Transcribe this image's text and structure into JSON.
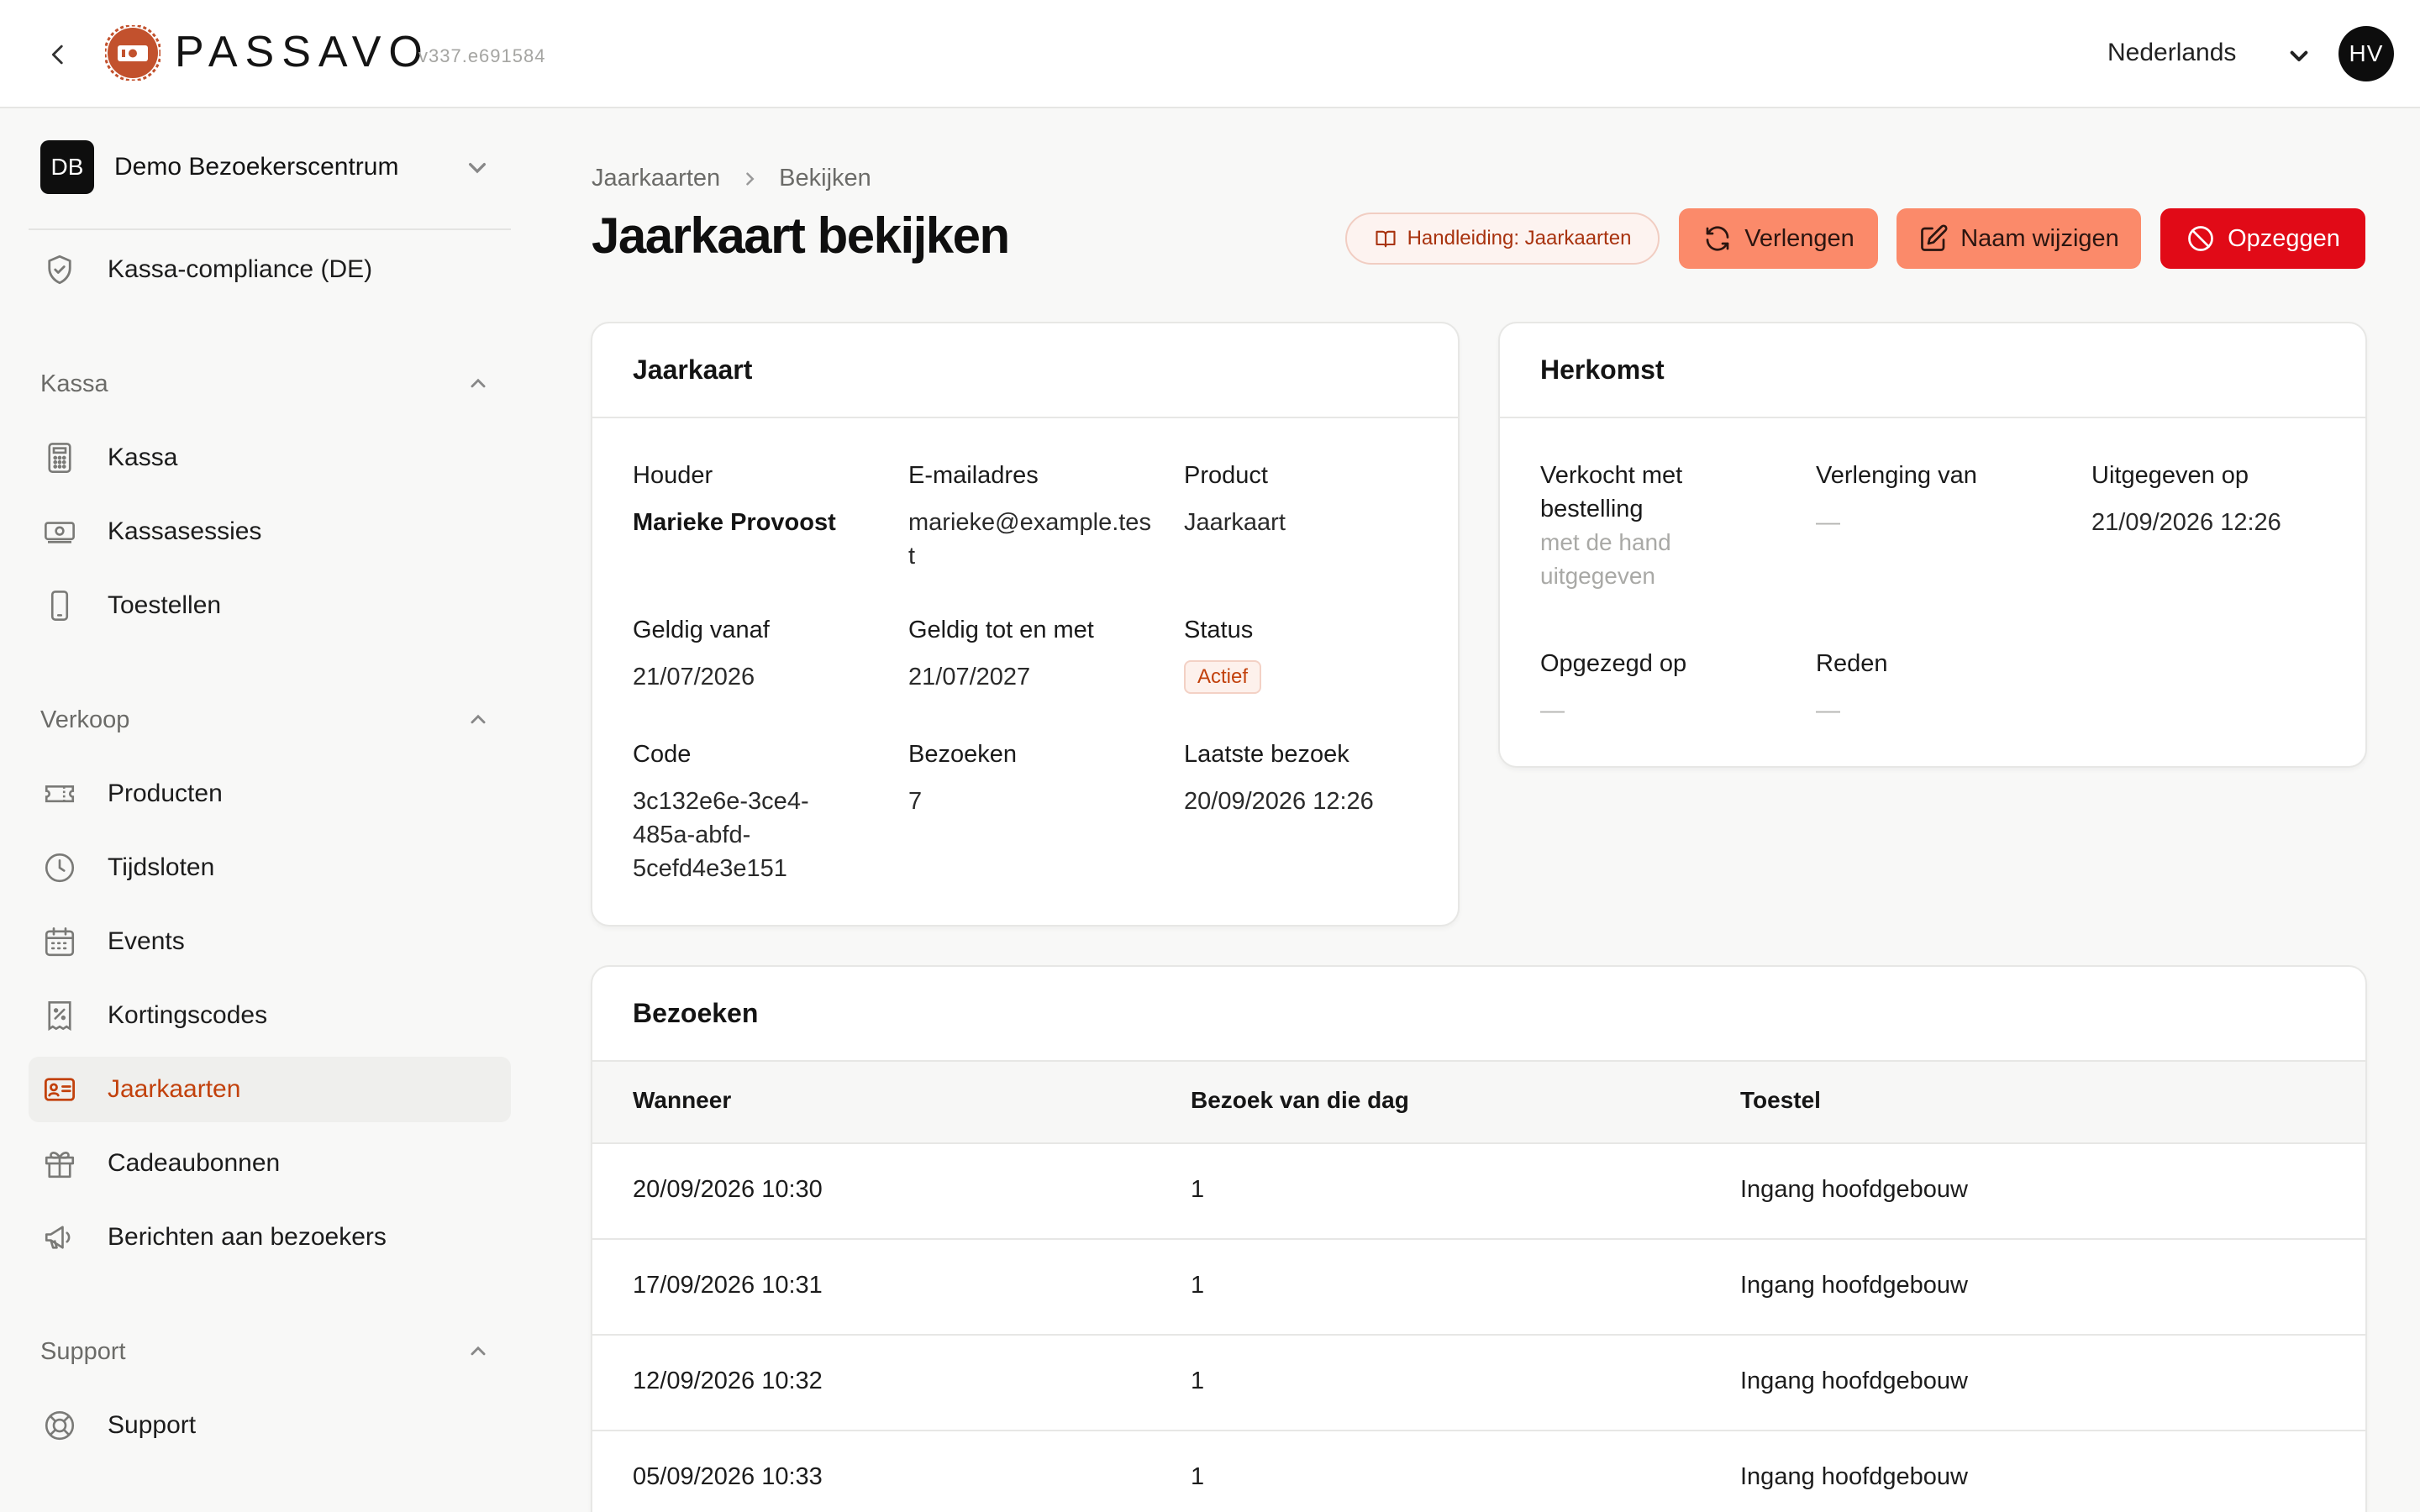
{
  "header": {
    "brand": "PASSAVO",
    "version": "v337.e691584",
    "language": "Nederlands",
    "avatar_initials": "HV"
  },
  "sidebar": {
    "org_initials": "DB",
    "org_name": "Demo Bezoekerscentrum",
    "compliance": "Kassa-compliance (DE)",
    "sections": [
      {
        "label": "Kassa",
        "items": [
          "Kassa",
          "Kassasessies",
          "Toestellen"
        ]
      },
      {
        "label": "Verkoop",
        "items": [
          "Producten",
          "Tijdsloten",
          "Events",
          "Kortingscodes",
          "Jaarkaarten",
          "Cadeaubonnen",
          "Berichten aan bezoekers"
        ]
      },
      {
        "label": "Support",
        "items": [
          "Support"
        ]
      }
    ],
    "active_item": "Jaarkaarten"
  },
  "breadcrumb": [
    "Jaarkaarten",
    "Bekijken"
  ],
  "page_title": "Jaarkaart bekijken",
  "actions": {
    "guide": "Handleiding: Jaarkaarten",
    "renew": "Verlengen",
    "rename": "Naam wijzigen",
    "cancel": "Opzeggen"
  },
  "colors": {
    "accent": "#fb8a6a",
    "danger": "#e10a17",
    "active_text": "#c2410c"
  },
  "card_pass": {
    "title": "Jaarkaart",
    "holder_label": "Houder",
    "holder": "Marieke Provoost",
    "email_label": "E-mailadres",
    "email": "marieke@example.test",
    "product_label": "Product",
    "product": "Jaarkaart",
    "valid_from_label": "Geldig vanaf",
    "valid_from": "21/07/2026",
    "valid_until_label": "Geldig tot en met",
    "valid_until": "21/07/2027",
    "status_label": "Status",
    "status": "Actief",
    "code_label": "Code",
    "code": "3c132e6e-3ce4-485a-abfd-5cefd4e3e151",
    "visits_label": "Bezoeken",
    "visits": "7",
    "last_visit_label": "Laatste bezoek",
    "last_visit": "20/09/2026 12:26"
  },
  "card_origin": {
    "title": "Herkomst",
    "sold_label": "Verkocht met bestelling",
    "sold": "met de hand uitgegeven",
    "renewal_label": "Verlenging van",
    "renewal": "—",
    "issued_label": "Uitgegeven op",
    "issued": "21/09/2026 12:26",
    "cancelled_label": "Opgezegd op",
    "cancelled": "—",
    "reason_label": "Reden",
    "reason": "—"
  },
  "visits_table": {
    "title": "Bezoeken",
    "columns": [
      "Wanneer",
      "Bezoek van die dag",
      "Toestel"
    ],
    "rows": [
      [
        "20/09/2026 10:30",
        "1",
        "Ingang hoofdgebouw"
      ],
      [
        "17/09/2026 10:31",
        "1",
        "Ingang hoofdgebouw"
      ],
      [
        "12/09/2026 10:32",
        "1",
        "Ingang hoofdgebouw"
      ],
      [
        "05/09/2026 10:33",
        "1",
        "Ingang hoofdgebouw"
      ]
    ]
  }
}
